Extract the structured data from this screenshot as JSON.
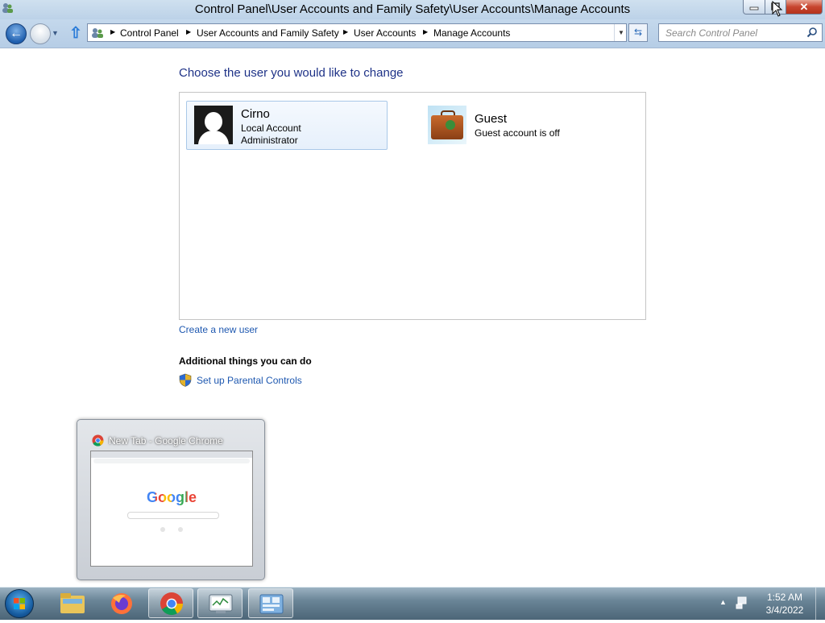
{
  "window": {
    "title": "Control Panel\\User Accounts and Family Safety\\User Accounts\\Manage Accounts",
    "close_glyph": "✕"
  },
  "navigation": {
    "back_glyph": "←",
    "breadcrumbs": [
      "Control Panel",
      "User Accounts and Family Safety",
      "User Accounts",
      "Manage Accounts"
    ],
    "search_placeholder": "Search Control Panel"
  },
  "main": {
    "heading": "Choose the user you would like to change",
    "accounts": [
      {
        "name": "Cirno",
        "lines": [
          "Local Account",
          "Administrator"
        ],
        "picture": "default-user-silhouette"
      },
      {
        "name": "Guest",
        "lines": [
          "Guest account is off"
        ],
        "picture": "suitcase"
      }
    ],
    "create_user_link": "Create a new user",
    "additional_heading": "Additional things you can do",
    "parental_controls_link": "Set up Parental Controls"
  },
  "thumbnail_preview": {
    "title": "New Tab - Google Chrome",
    "preview_logo": "Google"
  },
  "taskbar": {
    "apps": [
      "windows-explorer",
      "firefox",
      "google-chrome",
      "performance-monitor",
      "control-panel"
    ],
    "clock_time": "1:52 AM",
    "clock_date": "3/4/2022"
  },
  "colors": {
    "heading": "#1e3287",
    "link": "#1e58b0",
    "selection_border": "#a9c8e8"
  }
}
